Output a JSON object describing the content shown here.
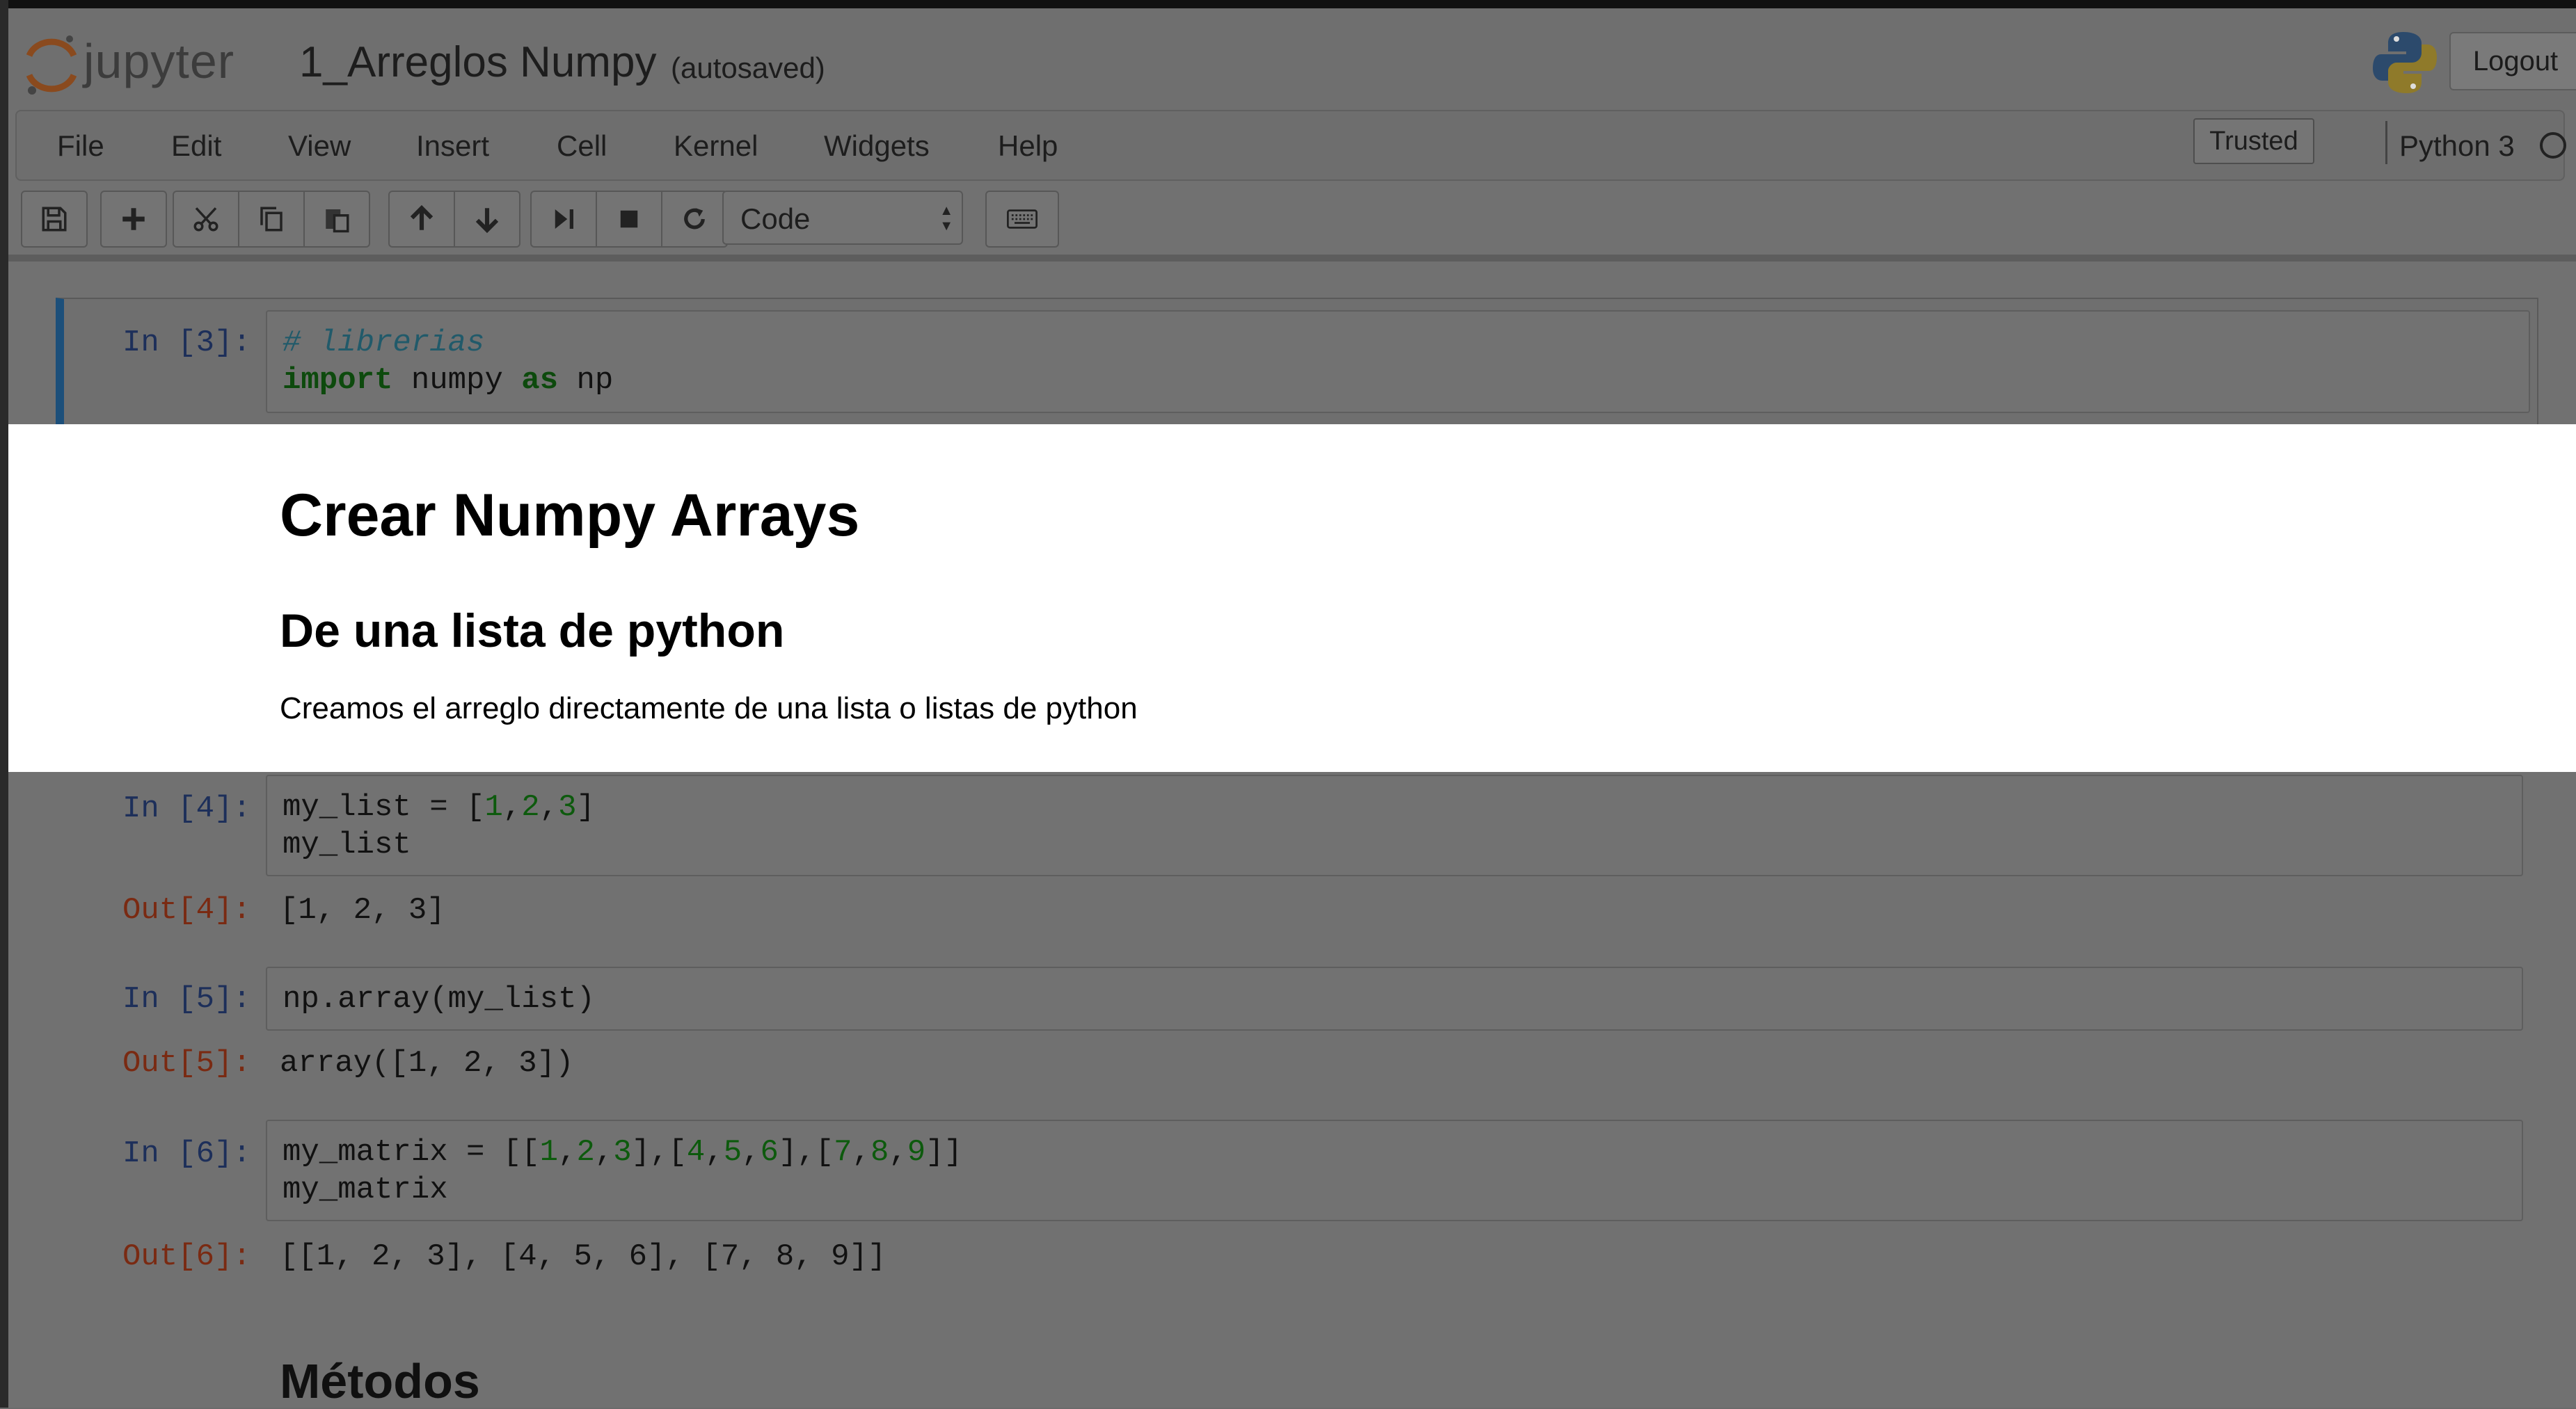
{
  "header": {
    "logo_text": "jupyter",
    "notebook_title": "1_Arreglos Numpy",
    "autosave_status": "(autosaved)",
    "logout_label": "Logout"
  },
  "menubar": {
    "items": [
      "File",
      "Edit",
      "View",
      "Insert",
      "Cell",
      "Kernel",
      "Widgets",
      "Help"
    ],
    "trusted_label": "Trusted",
    "kernel_name": "Python 3"
  },
  "toolbar": {
    "cell_type": "Code",
    "buttons": [
      "save-icon",
      "plus-icon",
      "cut-icon",
      "copy-icon",
      "paste-icon",
      "arrow-up-icon",
      "arrow-down-icon",
      "run-icon",
      "stop-icon",
      "restart-icon",
      "keyboard-icon"
    ]
  },
  "cells": [
    {
      "prompt": "In [3]:",
      "lines": [
        "# librerias",
        "import numpy as np"
      ]
    },
    {
      "markdown": {
        "h1": "Crear Numpy Arrays",
        "h2": "De una lista de python",
        "p": "Creamos el arreglo directamente de una lista o listas de python"
      }
    },
    {
      "prompt": "In [4]:",
      "lines": [
        "my_list = [1,2,3]",
        "my_list"
      ],
      "out_prompt": "Out[4]:",
      "output": "[1, 2, 3]"
    },
    {
      "prompt": "In [5]:",
      "lines": [
        "np.array(my_list)"
      ],
      "out_prompt": "Out[5]:",
      "output": "array([1, 2, 3])"
    },
    {
      "prompt": "In [6]:",
      "lines": [
        "my_matrix = [[1,2,3],[4,5,6],[7,8,9]]",
        "my_matrix"
      ],
      "out_prompt": "Out[6]:",
      "output": "[[1, 2, 3], [4, 5, 6], [7, 8, 9]]"
    },
    {
      "markdown": {
        "h2": "Métodos"
      }
    }
  ],
  "colors": {
    "selected_cell_border": "#1c4f7a",
    "in_prompt": "#1d2f5a",
    "out_prompt": "#7a2a12",
    "highlight": "#ffffff"
  }
}
